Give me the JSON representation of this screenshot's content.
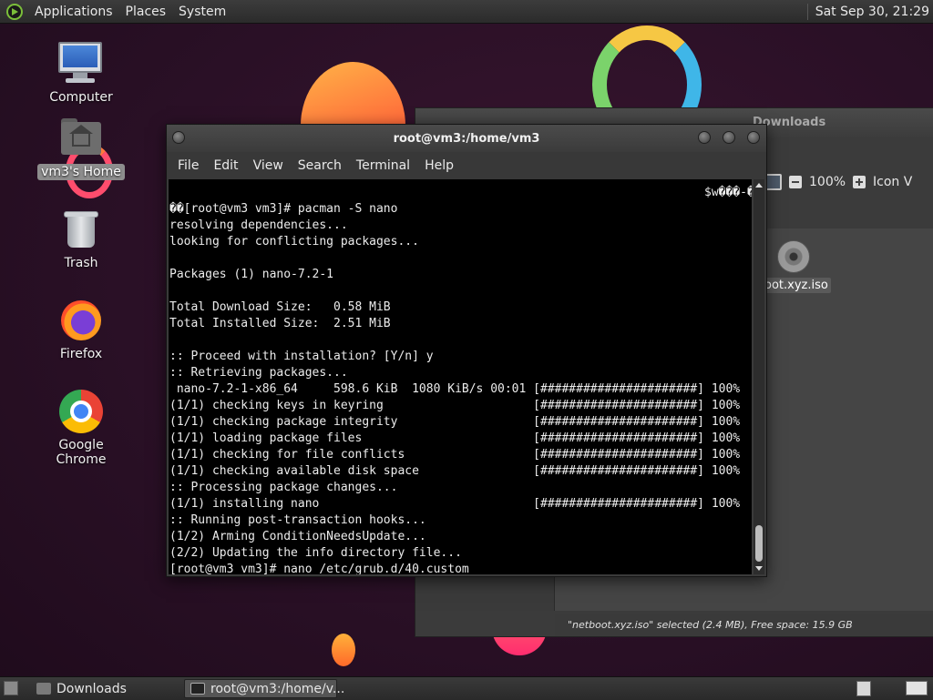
{
  "top_panel": {
    "menus": [
      "Applications",
      "Places",
      "System"
    ],
    "clock": "Sat Sep 30, 21:29"
  },
  "desktop": {
    "icons": [
      {
        "label": "Computer",
        "icon": "computer-icon"
      },
      {
        "label": "vm3's Home",
        "icon": "home-folder-icon",
        "selected": true
      },
      {
        "label": "Trash",
        "icon": "trash-icon"
      },
      {
        "label": "Firefox",
        "icon": "firefox-icon"
      },
      {
        "label": "Google Chrome",
        "icon": "chrome-icon"
      }
    ]
  },
  "file_manager": {
    "title": "Downloads",
    "zoom": "100%",
    "view_label": "Icon V",
    "file_name": "oot.xyz.iso",
    "status": "\"netboot.xyz.iso\" selected (2.4 MB), Free space: 15.9 GB"
  },
  "terminal": {
    "title": "root@vm3:/home/vm3",
    "menus": [
      "File",
      "Edit",
      "View",
      "Search",
      "Terminal",
      "Help"
    ],
    "output": "                                                                           $w���-�\n��[root@vm3 vm3]# pacman -S nano\nresolving dependencies...\nlooking for conflicting packages...\n\nPackages (1) nano-7.2-1\n\nTotal Download Size:   0.58 MiB\nTotal Installed Size:  2.51 MiB\n\n:: Proceed with installation? [Y/n] y\n:: Retrieving packages...\n nano-7.2-1-x86_64     598.6 KiB  1080 KiB/s 00:01 [######################] 100%\n(1/1) checking keys in keyring                     [######################] 100%\n(1/1) checking package integrity                   [######################] 100%\n(1/1) loading package files                        [######################] 100%\n(1/1) checking for file conflicts                  [######################] 100%\n(1/1) checking available disk space                [######################] 100%\n:: Processing package changes...\n(1/1) installing nano                              [######################] 100%\n:: Running post-transaction hooks...\n(1/2) Arming ConditionNeedsUpdate...\n(2/2) Updating the info directory file...\n[root@vm3 vm3]# nano /etc/grub.d/40.custom"
  },
  "taskbar": {
    "tasks": [
      {
        "label": "Downloads",
        "active": false
      },
      {
        "label": "root@vm3:/home/v...",
        "active": true
      }
    ]
  }
}
